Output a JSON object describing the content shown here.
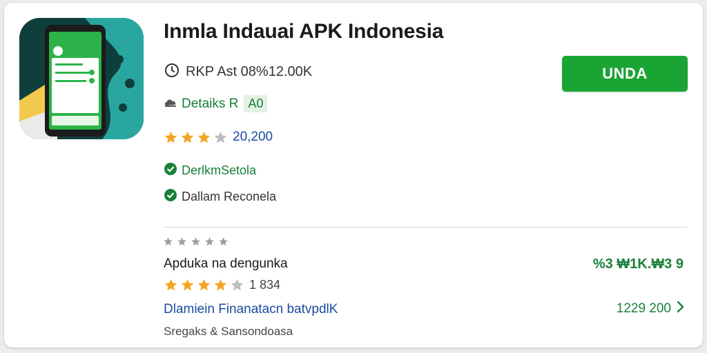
{
  "app": {
    "title": "Inmla Indauai APK Indonesia",
    "size_text": "RKP Ast 08%12.00K",
    "details_label": "Detaiks R",
    "details_badge": "A0",
    "rating_stars": 3,
    "rating_count": "20,200",
    "check_1": "DerlkmSetola",
    "check_2": "Dallam Reconela",
    "install_label": "UNDA"
  },
  "section": {
    "small_stars": 5,
    "title": "Apduka na dengunka",
    "value": "%3 ₩1K.₩3 9",
    "rating_stars": 4,
    "rating_count": "1 834",
    "link_text": "Dlamiein Finanatacn batvpdlK",
    "link_value": "1229 200",
    "footer": "Sregaks & Sansondoasa"
  },
  "icons": {
    "size": "download-clock-icon",
    "details": "cloud-icon",
    "check": "check-circle-icon",
    "chevron": "chevron-right-icon"
  },
  "colors": {
    "accent_green": "#1aa434",
    "text_green": "#188038",
    "link_blue": "#1a4ba0",
    "star_gold": "#f4a522",
    "star_gray": "#bdbdbd"
  }
}
